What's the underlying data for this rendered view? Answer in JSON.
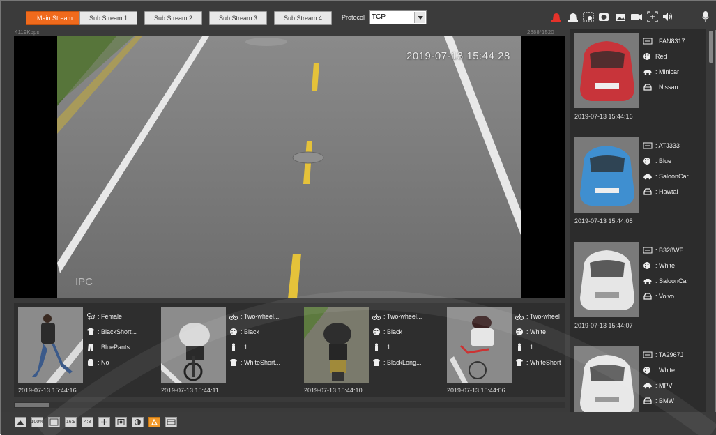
{
  "stream_tabs": [
    {
      "label": "Main Stream",
      "active": true
    },
    {
      "label": "Sub Stream 1",
      "active": false
    },
    {
      "label": "Sub Stream 2",
      "active": false
    },
    {
      "label": "Sub Stream 3",
      "active": false
    },
    {
      "label": "Sub Stream 4",
      "active": false
    }
  ],
  "protocol": {
    "label": "Protocol",
    "value": "TCP"
  },
  "toolbar_icons": [
    "alarm-icon",
    "alarm-output-icon",
    "regional-focus-icon",
    "snapshot-icon",
    "triple-snapshot-icon",
    "record-icon",
    "digital-zoom-icon",
    "audio-icon",
    "talk-icon"
  ],
  "video": {
    "bitrate": "4119Kbps",
    "resolution": "2688*1520",
    "osd_time": "2019-07-13 15:44:28",
    "osd_channel": "IPC"
  },
  "people": [
    {
      "time": "2019-07-13 15:44:16",
      "attrs": [
        {
          "icon": "gender-icon",
          "value": ": Female"
        },
        {
          "icon": "top-clothes-icon",
          "value": ": BlackShort..."
        },
        {
          "icon": "pants-icon",
          "value": ": BluePants"
        },
        {
          "icon": "bag-icon",
          "value": ": No"
        }
      ]
    },
    {
      "time": "2019-07-13 15:44:11",
      "attrs": [
        {
          "icon": "bicycle-icon",
          "value": ": Two-wheel..."
        },
        {
          "icon": "color-palette-icon",
          "value": ": Black"
        },
        {
          "icon": "person-icon",
          "value": ": 1"
        },
        {
          "icon": "top-clothes-icon",
          "value": ": WhiteShort..."
        }
      ]
    },
    {
      "time": "2019-07-13 15:44:10",
      "attrs": [
        {
          "icon": "bicycle-icon",
          "value": ": Two-wheel..."
        },
        {
          "icon": "color-palette-icon",
          "value": ": Black"
        },
        {
          "icon": "person-icon",
          "value": ": 1"
        },
        {
          "icon": "top-clothes-icon",
          "value": ": BlackLong..."
        }
      ]
    },
    {
      "time": "2019-07-13 15:44:06",
      "attrs": [
        {
          "icon": "bicycle-icon",
          "value": ": Two-wheel"
        },
        {
          "icon": "color-palette-icon",
          "value": ": White"
        },
        {
          "icon": "person-icon",
          "value": ": 1"
        },
        {
          "icon": "top-clothes-icon",
          "value": ": WhiteShort"
        }
      ]
    }
  ],
  "vehicles": [
    {
      "time": "2019-07-13 15:44:16",
      "plate": ": FAN8317",
      "color": "Red",
      "type": ": Minicar",
      "brand": ": Nissan",
      "car_color": "#c8343a"
    },
    {
      "time": "2019-07-13 15:44:08",
      "plate": ": ATJ333",
      "color": ": Blue",
      "type": ": SaloonCar",
      "brand": ": Hawtai",
      "car_color": "#3f8fd0"
    },
    {
      "time": "2019-07-13 15:44:07",
      "plate": ": B328WE",
      "color": ": White",
      "type": ": SaloonCar",
      "brand": ": Volvo",
      "car_color": "#e6e6e6"
    },
    {
      "time": "",
      "plate": ": TA2967J",
      "color": ": White",
      "type": ": MPV",
      "brand": ": BMW",
      "car_color": "#e8e8e8"
    }
  ],
  "bottom_icons": [
    "fullscreen-icon",
    "original-size-icon",
    "fit-window-icon",
    "wide-icon",
    "window-icon",
    "ptz-icon",
    "zoom-focus-icon",
    "image-adjust-icon",
    "rules-icon",
    "face-overlay-icon"
  ],
  "bottom_labels": {
    "original_size": "100%",
    "ratio1": "16:9",
    "ratio2": "4:3"
  }
}
